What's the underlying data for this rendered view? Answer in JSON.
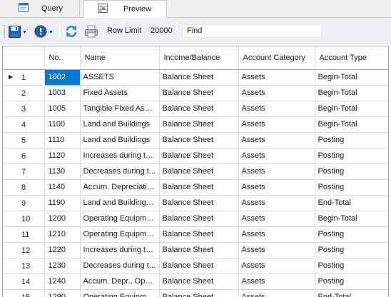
{
  "tabs": [
    {
      "label": "Query",
      "icon": "query-window-icon",
      "active": false
    },
    {
      "label": "Preview",
      "icon": "preview-sheet-icon",
      "active": true
    }
  ],
  "toolbar": {
    "save_icon": "floppy-disk-icon",
    "status_icon": "info-circle-icon",
    "refresh_icon": "refresh-icon",
    "print_icon": "printer-icon",
    "row_limit_label": "Row Limit",
    "row_limit_value": "20000",
    "find_label": "Find",
    "find_value": ""
  },
  "colors": {
    "selection": "#0078d7",
    "icon_blue": "#1e5fb4"
  },
  "grid": {
    "columns": [
      "No.",
      "Name",
      "Income/Balance",
      "Account Category",
      "Account Type"
    ],
    "current_row": 0,
    "rows": [
      {
        "index": "1",
        "no": "1002",
        "name": "ASSETS",
        "income_balance": "Balance Sheet",
        "category": "Assets",
        "type": "Begin-Total"
      },
      {
        "index": "2",
        "no": "1003",
        "name": "Fixed Assets",
        "income_balance": "Balance Sheet",
        "category": "Assets",
        "type": "Begin-Total"
      },
      {
        "index": "3",
        "no": "1005",
        "name": "Tangible Fixed Assets",
        "income_balance": "Balance Sheet",
        "category": "Assets",
        "type": "Begin-Total"
      },
      {
        "index": "4",
        "no": "1100",
        "name": "Land and Buildings",
        "income_balance": "Balance Sheet",
        "category": "Assets",
        "type": "Begin-Total"
      },
      {
        "index": "5",
        "no": "1110",
        "name": "Land and Buildings",
        "income_balance": "Balance Sheet",
        "category": "Assets",
        "type": "Posting"
      },
      {
        "index": "6",
        "no": "1120",
        "name": "Increases during th...",
        "income_balance": "Balance Sheet",
        "category": "Assets",
        "type": "Posting"
      },
      {
        "index": "7",
        "no": "1130",
        "name": "Decreases during t...",
        "income_balance": "Balance Sheet",
        "category": "Assets",
        "type": "Posting"
      },
      {
        "index": "8",
        "no": "1140",
        "name": "Accum. Depreciatio...",
        "income_balance": "Balance Sheet",
        "category": "Assets",
        "type": "Posting"
      },
      {
        "index": "9",
        "no": "1190",
        "name": "Land and Buildings,...",
        "income_balance": "Balance Sheet",
        "category": "Assets",
        "type": "End-Total"
      },
      {
        "index": "10",
        "no": "1200",
        "name": "Operating Equipment",
        "income_balance": "Balance Sheet",
        "category": "Assets",
        "type": "Begin-Total"
      },
      {
        "index": "11",
        "no": "1210",
        "name": "Operating Equipment",
        "income_balance": "Balance Sheet",
        "category": "Assets",
        "type": "Posting"
      },
      {
        "index": "12",
        "no": "1220",
        "name": "Increases during th...",
        "income_balance": "Balance Sheet",
        "category": "Assets",
        "type": "Posting"
      },
      {
        "index": "13",
        "no": "1230",
        "name": "Decreases during t...",
        "income_balance": "Balance Sheet",
        "category": "Assets",
        "type": "Posting"
      },
      {
        "index": "14",
        "no": "1240",
        "name": "Accum. Depr., Oper...",
        "income_balance": "Balance Sheet",
        "category": "Assets",
        "type": "Posting"
      },
      {
        "index": "15",
        "no": "1290",
        "name": "Operating Equipme...",
        "income_balance": "Balance Sheet",
        "category": "Assets",
        "type": "End-Total"
      }
    ]
  }
}
